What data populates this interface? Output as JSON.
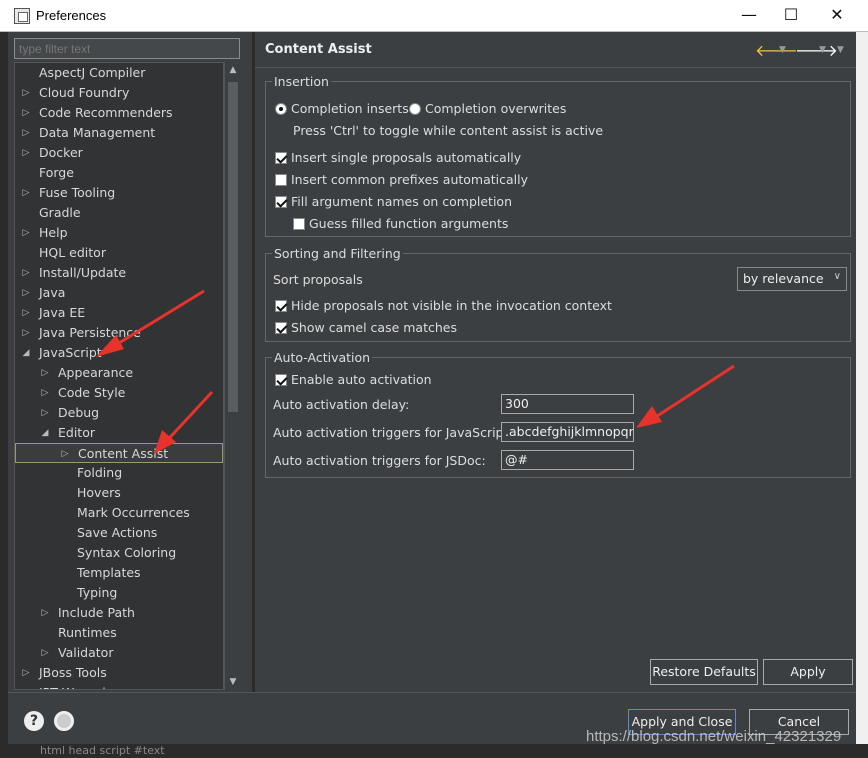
{
  "window": {
    "title": "Preferences",
    "minimize": "—",
    "maximize": "☐",
    "close": "✕"
  },
  "filter": {
    "placeholder": "type filter text"
  },
  "tree": [
    {
      "label": "AspectJ Compiler",
      "level": 0,
      "arrow": ""
    },
    {
      "label": "Cloud Foundry",
      "level": 0,
      "arrow": "▷"
    },
    {
      "label": "Code Recommenders",
      "level": 0,
      "arrow": "▷"
    },
    {
      "label": "Data Management",
      "level": 0,
      "arrow": "▷"
    },
    {
      "label": "Docker",
      "level": 0,
      "arrow": "▷"
    },
    {
      "label": "Forge",
      "level": 0,
      "arrow": ""
    },
    {
      "label": "Fuse Tooling",
      "level": 0,
      "arrow": "▷"
    },
    {
      "label": "Gradle",
      "level": 0,
      "arrow": ""
    },
    {
      "label": "Help",
      "level": 0,
      "arrow": "▷"
    },
    {
      "label": "HQL editor",
      "level": 0,
      "arrow": ""
    },
    {
      "label": "Install/Update",
      "level": 0,
      "arrow": "▷"
    },
    {
      "label": "Java",
      "level": 0,
      "arrow": "▷"
    },
    {
      "label": "Java EE",
      "level": 0,
      "arrow": "▷"
    },
    {
      "label": "Java Persistence",
      "level": 0,
      "arrow": "▷"
    },
    {
      "label": "JavaScript",
      "level": 0,
      "arrow": "◢"
    },
    {
      "label": "Appearance",
      "level": 1,
      "arrow": "▷"
    },
    {
      "label": "Code Style",
      "level": 1,
      "arrow": "▷"
    },
    {
      "label": "Debug",
      "level": 1,
      "arrow": "▷"
    },
    {
      "label": "Editor",
      "level": 1,
      "arrow": "◢"
    },
    {
      "label": "Content Assist",
      "level": 2,
      "arrow": "▷",
      "selected": true
    },
    {
      "label": "Folding",
      "level": 2,
      "arrow": ""
    },
    {
      "label": "Hovers",
      "level": 2,
      "arrow": ""
    },
    {
      "label": "Mark Occurrences",
      "level": 2,
      "arrow": ""
    },
    {
      "label": "Save Actions",
      "level": 2,
      "arrow": ""
    },
    {
      "label": "Syntax Coloring",
      "level": 2,
      "arrow": ""
    },
    {
      "label": "Templates",
      "level": 2,
      "arrow": ""
    },
    {
      "label": "Typing",
      "level": 2,
      "arrow": ""
    },
    {
      "label": "Include Path",
      "level": 1,
      "arrow": "▷"
    },
    {
      "label": "Runtimes",
      "level": 1,
      "arrow": ""
    },
    {
      "label": "Validator",
      "level": 1,
      "arrow": "▷"
    },
    {
      "label": "JBoss Tools",
      "level": 0,
      "arrow": "▷"
    },
    {
      "label": "JPT Wrapping",
      "level": 0,
      "arrow": "▷"
    }
  ],
  "page": {
    "title": "Content Assist",
    "insertion": {
      "legend": "Insertion",
      "radio_inserts": "Completion inserts",
      "radio_overwrites": "Completion overwrites",
      "toggle_hint": "Press 'Ctrl' to toggle while content assist is active",
      "single_proposals": "Insert single proposals automatically",
      "common_prefixes": "Insert common prefixes automatically",
      "fill_args": "Fill argument names on completion",
      "guess_args": "Guess filled function arguments"
    },
    "sorting": {
      "legend": "Sorting and Filtering",
      "sort_label": "Sort proposals",
      "sort_value": "by relevance",
      "hide_proposals": "Hide proposals not visible in the invocation context",
      "camel_case": "Show camel case matches"
    },
    "auto": {
      "legend": "Auto-Activation",
      "enable": "Enable auto activation",
      "delay_label": "Auto activation delay:",
      "delay_value": "300",
      "js_label": "Auto activation triggers for JavaScript:",
      "js_value": ".abcdefghijklmnopqrs",
      "jsdoc_label": "Auto activation triggers for JSDoc:",
      "jsdoc_value": "@#"
    },
    "restore_defaults": "Restore Defaults",
    "apply": "Apply"
  },
  "buttons": {
    "apply_close": "Apply and Close",
    "cancel": "Cancel"
  },
  "background": {
    "ide_tabs": "html   head   script   #text"
  },
  "watermark": "https://blog.csdn.net/weixin_42321329",
  "colors": {
    "annotation_arrow": "#e8322c",
    "dialog_bg": "#3c3f41",
    "tree_bg": "#313335"
  }
}
